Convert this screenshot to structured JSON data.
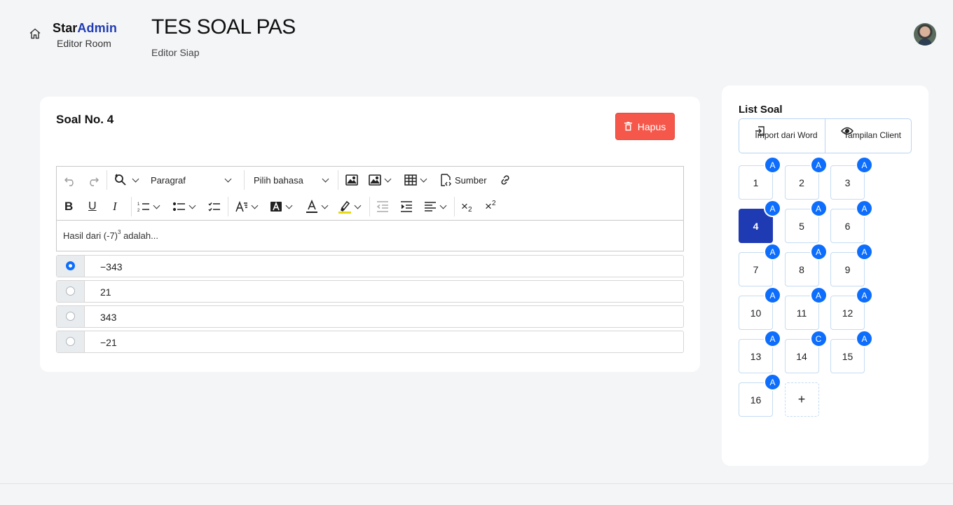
{
  "brand": {
    "part1": "Star",
    "part2": "Admin",
    "subtitle": "Editor Room"
  },
  "header": {
    "title": "TES SOAL PAS",
    "subtitle": "Editor Siap"
  },
  "question": {
    "title": "Soal No. 4",
    "delete_label": "Hapus",
    "text_before": "Hasil dari (-7)",
    "text_sup": "3",
    "text_after": " adalah...",
    "options": [
      {
        "text": "−343",
        "selected": true
      },
      {
        "text": "21",
        "selected": false
      },
      {
        "text": "343",
        "selected": false
      },
      {
        "text": "−21",
        "selected": false
      }
    ]
  },
  "toolbar": {
    "paragraph": "Paragraf",
    "language": "Pilih bahasa",
    "source": "Sumber",
    "subscript_label": "2",
    "superscript_label": "2"
  },
  "sidebar": {
    "title": "List Soal",
    "import_label": "Import dari Word",
    "preview_label": "Tampilan Client",
    "questions": [
      {
        "num": "1",
        "ans": "A"
      },
      {
        "num": "2",
        "ans": "A"
      },
      {
        "num": "3",
        "ans": "A"
      },
      {
        "num": "4",
        "ans": "A"
      },
      {
        "num": "5",
        "ans": "A"
      },
      {
        "num": "6",
        "ans": "A"
      },
      {
        "num": "7",
        "ans": "A"
      },
      {
        "num": "8",
        "ans": "A"
      },
      {
        "num": "9",
        "ans": "A"
      },
      {
        "num": "10",
        "ans": "A"
      },
      {
        "num": "11",
        "ans": "A"
      },
      {
        "num": "12",
        "ans": "A"
      },
      {
        "num": "13",
        "ans": "A"
      },
      {
        "num": "14",
        "ans": "C"
      },
      {
        "num": "15",
        "ans": "A"
      },
      {
        "num": "16",
        "ans": "A"
      }
    ],
    "active_index": 3,
    "add_label": "+"
  },
  "colors": {
    "accent": "#1f3bb3",
    "badge": "#0d6efd",
    "danger": "#f5574a"
  }
}
